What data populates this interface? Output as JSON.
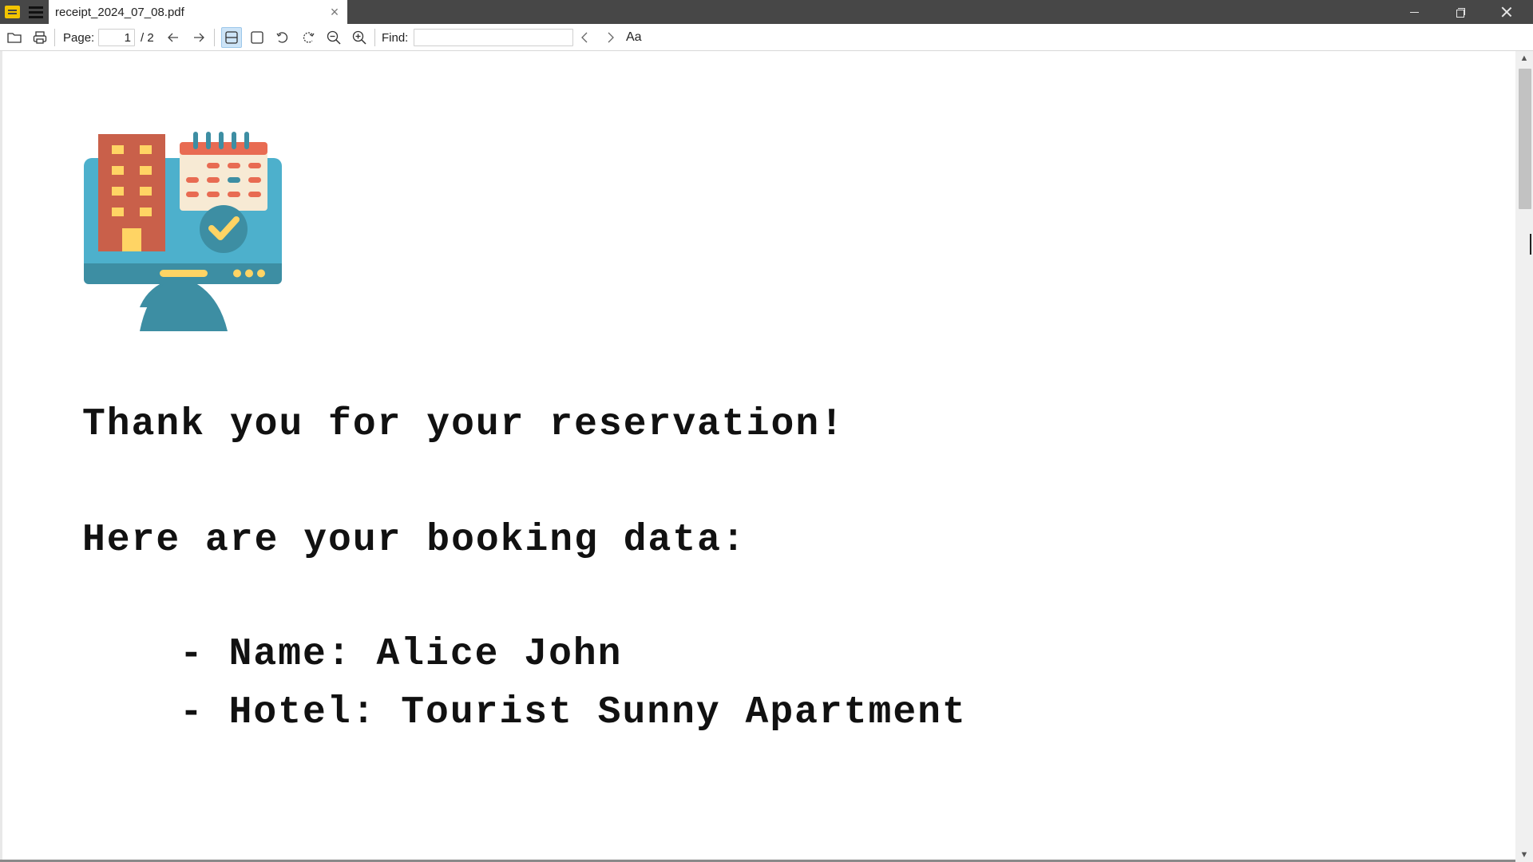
{
  "window": {
    "tab_title": "receipt_2024_07_08.pdf",
    "close_tab_glyph": "×",
    "icons": [
      "app-logo",
      "hamburger-menu-icon",
      "minimize-icon",
      "restore-icon",
      "close-icon"
    ]
  },
  "toolbar": {
    "page_label": "Page:",
    "page_current": "1",
    "page_total": "/ 2",
    "find_label": "Find:",
    "find_value": "",
    "match_case_label": "Aa",
    "icons": [
      "open-file-icon",
      "print-icon",
      "previous-page-icon",
      "next-page-icon",
      "continuous-view-icon",
      "single-page-view-icon",
      "rotate-left-icon",
      "rotate-right-icon",
      "zoom-out-icon",
      "zoom-in-icon",
      "find-previous-icon",
      "find-next-icon",
      "match-case-icon"
    ],
    "active_view": "continuous-view"
  },
  "document": {
    "lines": {
      "thanks": "Thank you for your reservation!",
      "intro": "Here are your booking data:",
      "name": "- Name: Alice John",
      "hotel": "- Hotel: Tourist Sunny Apartment"
    },
    "illustration": "hotel-booking-icon"
  },
  "colors": {
    "titlebar": "#474747",
    "accent_blue": "#4db0cc",
    "building": "#c9604a",
    "window_yellow": "#ffd464",
    "calendar_red": "#e86b52",
    "monitor_dark": "#3d8ea3",
    "active_button": "#cde4f7"
  }
}
